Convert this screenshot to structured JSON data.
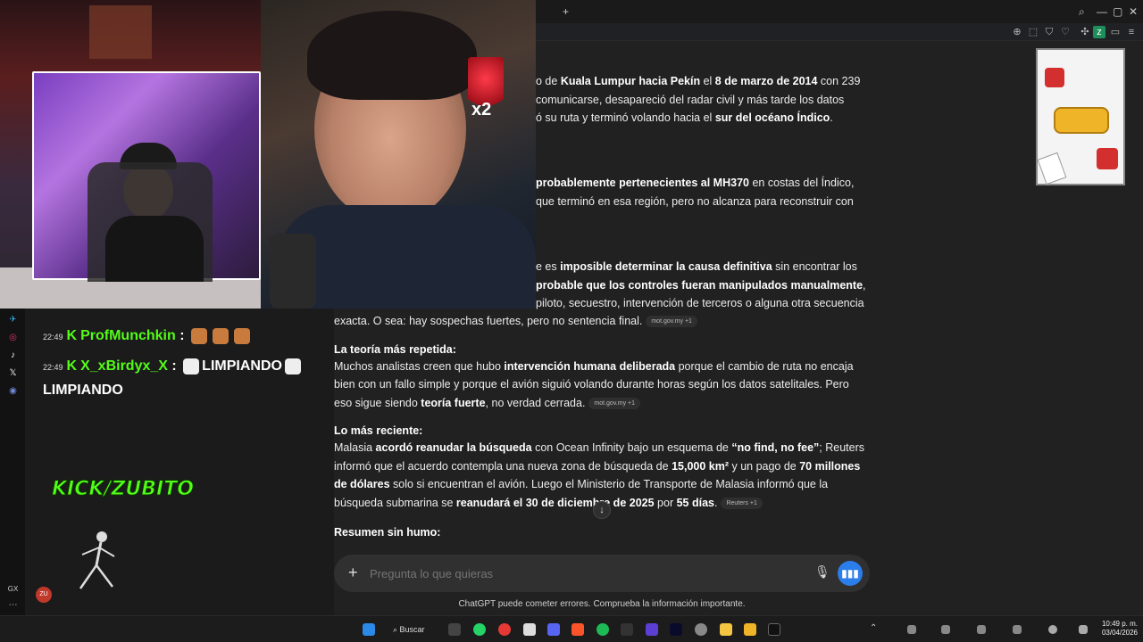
{
  "chat": {
    "messages": [
      {
        "time": "22:49",
        "user": "ProfMunchkin",
        "sep": ":",
        "text": ""
      },
      {
        "time": "22:49",
        "user": "X_xBirdyx_X",
        "sep": ":",
        "text": "LIMPIANDO",
        "cont": "LIMPIANDO"
      }
    ],
    "brand": "KICK/ZUBITO",
    "overlay_badge": "x2",
    "avatar_initials": "ZU",
    "sidebar_label": "GX"
  },
  "content": {
    "para1_l1_a": "o de ",
    "para1_l1_b": "Kuala Lumpur hacia Pekín",
    "para1_l1_c": " el ",
    "para1_l1_d": "8 de marzo de 2014",
    "para1_l1_e": " con 239",
    "para1_l2": "comunicarse, desapareció del radar civil y más tarde los datos",
    "para1_l3_a": "ó su ruta y terminó volando hacia el ",
    "para1_l3_b": "sur del océano Índico",
    "para1_l3_c": ".",
    "para2_l1_a": "probablemente pertenecientes al MH370",
    "para2_l1_b": " en costas del Índico,",
    "para2_l2": "que terminó en esa región, pero no alcanza para reconstruir con",
    "para3_l1_a": "e es ",
    "para3_l1_b": "imposible determinar la causa definitiva",
    "para3_l1_c": " sin encontrar los",
    "para3_l2_a": "probable que los controles fueran manipulados manualmente",
    "para3_l2_b": ",",
    "para3_l3": "piloto, secuestro, intervención de terceros o alguna otra secuencia",
    "para3_l4": "exacta. O sea: hay sospechas fuertes, pero no sentencia final.",
    "chip1": "mot.gov.my  +1",
    "h2": "La teoría más repetida:",
    "para4_a": "Muchos analistas creen que hubo ",
    "para4_b": "intervención humana deliberada",
    "para4_c": " porque el cambio de ruta no encaja bien con un fallo simple y porque el avión siguió volando durante horas según los datos satelitales. Pero eso sigue siendo ",
    "para4_d": "teoría fuerte",
    "para4_e": ", no verdad cerrada.",
    "chip2": "mot.gov.my  +1",
    "h3": "Lo más reciente:",
    "para5_a": "Malasia ",
    "para5_b": "acordó reanudar la búsqueda",
    "para5_c": " con Ocean Infinity bajo un esquema de ",
    "para5_d": "“no find, no fee”",
    "para5_e": "; Reuters informó que el acuerdo contempla una nueva zona de búsqueda de ",
    "para5_f": "15,000 km²",
    "para5_g": " y un pago de ",
    "para5_h": "70 millones de dólares",
    "para5_i": " solo si encuentran el avión. Luego el Ministerio de Transporte de Malasia informó que la búsqueda submarina se ",
    "para5_j": "reanudará el 30 de diciembre de 2025",
    "para5_k": " por ",
    "para5_l": "55 días",
    "para5_m": ".",
    "chip3": "Reuters  +1",
    "h4": "Resumen sin humo:"
  },
  "input": {
    "placeholder": "Pregunta lo que quieras",
    "plus": "+"
  },
  "disclaimer": "ChatGPT puede cometer errores. Comprueba la información importante.",
  "taskbar": {
    "search_label": "Buscar",
    "time": "10:49 p. m.",
    "date": "03/04/2026"
  },
  "colors": {
    "kick_green": "#53fc18",
    "bg": "#212121",
    "mic_blue": "#2b7de9"
  }
}
